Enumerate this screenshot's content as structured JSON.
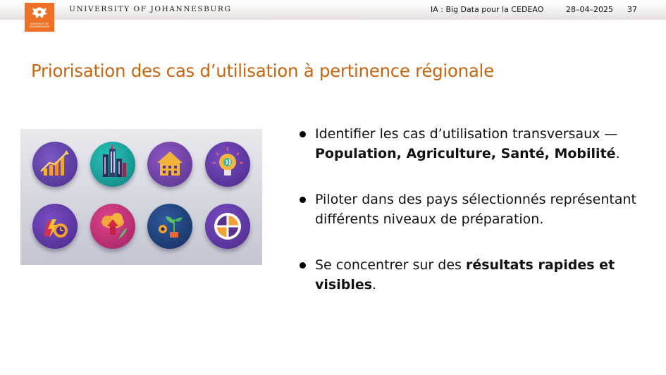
{
  "header": {
    "university": "UNIVERSITY OF JOHANNESBURG",
    "course": "IA : Big Data pour la CEDEAO",
    "date": "28–04–2025",
    "page_number": "37",
    "logo_text": "UNIVERSITY OF JOHANNESBURG"
  },
  "slide": {
    "title": "Priorisation des cas d’utilisation à pertinence régionale"
  },
  "icons": [
    {
      "name": "growth-chart-icon",
      "bg": "#5b3fa0"
    },
    {
      "name": "city-buildings-icon",
      "bg": "#17a9a1"
    },
    {
      "name": "house-icon",
      "bg": "#6b3fa3"
    },
    {
      "name": "lightbulb-icon",
      "bg": "#5c3aa0"
    },
    {
      "name": "energy-gear-icon",
      "bg": "#5a3fa2"
    },
    {
      "name": "cloud-upload-icon",
      "bg": "#c42f74"
    },
    {
      "name": "plant-gear-icon",
      "bg": "#224680"
    },
    {
      "name": "crosshair-icon",
      "bg": "#5b3fa2"
    }
  ],
  "bullets": [
    {
      "line1": "Identifier les cas d’utilisation transversaux —",
      "bold": "Population, Agriculture, Santé, Mobilité",
      "after": "."
    },
    {
      "line1": "Piloter dans des pays sélectionnés représentant",
      "line2": "différents niveaux de préparation."
    },
    {
      "before": "Se concentrer sur des ",
      "bold1": "résultats rapides et",
      "bold2": "visibles",
      "after": "."
    }
  ]
}
